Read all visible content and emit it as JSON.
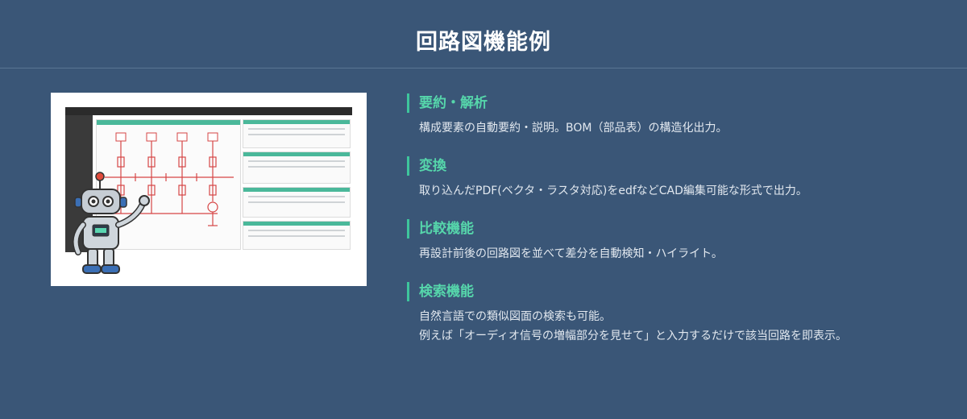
{
  "page": {
    "title": "回路図機能例"
  },
  "features": [
    {
      "heading": "要約・解析",
      "lines": [
        "構成要素の自動要約・説明。BOM（部品表）の構造化出力。"
      ]
    },
    {
      "heading": "変換",
      "lines": [
        "取り込んだPDF(ベクタ・ラスタ対応)をedfなどCAD編集可能な形式で出力。"
      ]
    },
    {
      "heading": "比較機能",
      "lines": [
        "再設計前後の回路図を並べて差分を自動検知・ハイライト。"
      ]
    },
    {
      "heading": "検索機能",
      "lines": [
        "自然言語での類似図面の検索も可能。",
        "例えば「オーディオ信号の増幅部分を見せて」と入力するだけで該当回路を即表示。"
      ]
    }
  ],
  "colors": {
    "background": "#3a5677",
    "accent": "#56d6ab",
    "accent_bar": "#3ec59c"
  }
}
